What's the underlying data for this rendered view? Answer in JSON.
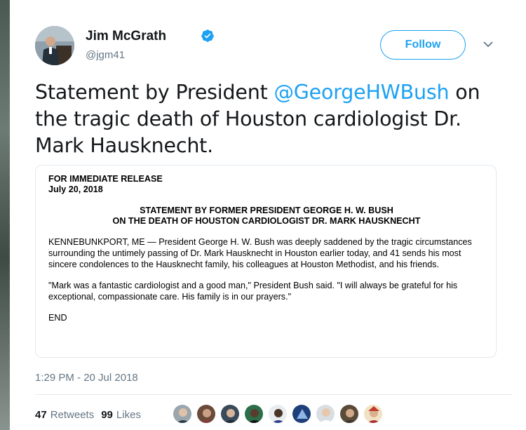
{
  "tweet": {
    "author_name": "Jim McGrath",
    "author_handle": "@jgm41",
    "follow_label": "Follow",
    "text_before": "Statement by President ",
    "mention": "@GeorgeHWBush",
    "text_after": " on the tragic death of Houston cardiologist Dr. Mark Hausknecht.",
    "timestamp": "1:29 PM - 20 Jul 2018",
    "retweets_count": "47",
    "retweets_label": "Retweets",
    "likes_count": "99",
    "likes_label": "Likes"
  },
  "press_release": {
    "line1": "FOR IMMEDIATE RELEASE",
    "line2": "July 20, 2018",
    "title1": "STATEMENT BY FORMER PRESIDENT GEORGE H. W. BUSH",
    "title2": "ON THE DEATH OF HOUSTON CARDIOLOGIST DR. MARK HAUSKNECHT",
    "para1": "KENNEBUNKPORT, ME — President George H. W. Bush was deeply saddened by the tragic circumstances surrounding the untimely passing of Dr. Mark Hausknecht in Houston earlier today, and 41 sends his most sincere condolences to the Hausknecht family, his colleagues at Houston Methodist, and his friends.",
    "para2": "\"Mark was a fantastic cardiologist and a good man,\" President Bush said. \"I will always be grateful for his exceptional, compassionate care. His family is in our prayers.\"",
    "end": "END"
  },
  "colors": {
    "accent": "#1da1f2",
    "text": "#14171a",
    "muted": "#657786",
    "verified": "#1da1f2"
  },
  "icons": {
    "verified": "verified-badge-icon",
    "caret": "chevron-down-icon"
  },
  "liker_avatars": 9
}
